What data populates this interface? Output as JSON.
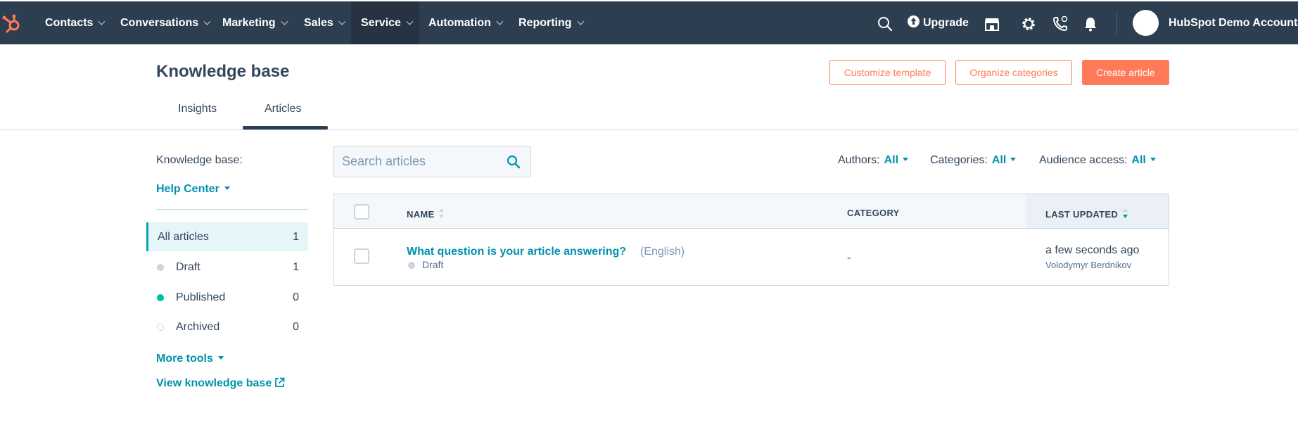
{
  "nav": {
    "items": [
      {
        "label": "Contacts"
      },
      {
        "label": "Conversations"
      },
      {
        "label": "Marketing"
      },
      {
        "label": "Sales"
      },
      {
        "label": "Service"
      },
      {
        "label": "Automation"
      },
      {
        "label": "Reporting"
      }
    ],
    "active_item": "Service",
    "upgrade_label": "Upgrade",
    "account_name": "HubSpot Demo Account",
    "icons": [
      "search-icon",
      "marketplace-icon",
      "settings-gear-icon",
      "calling-icon",
      "notifications-bell-icon"
    ]
  },
  "header": {
    "title": "Knowledge base",
    "buttons": {
      "customize": "Customize template",
      "organize": "Organize categories",
      "create": "Create article"
    },
    "tabs": [
      {
        "label": "Insights"
      },
      {
        "label": "Articles"
      }
    ],
    "active_tab": "Articles"
  },
  "sidebar": {
    "heading": "Knowledge base:",
    "kb_selector": "Help Center",
    "items": [
      {
        "label": "All articles",
        "count": "1"
      },
      {
        "label": "Draft",
        "count": "1"
      },
      {
        "label": "Published",
        "count": "0"
      },
      {
        "label": "Archived",
        "count": "0"
      }
    ],
    "more_tools": "More tools",
    "view_kb": "View knowledge base"
  },
  "filters": {
    "search_placeholder": "Search articles",
    "authors": {
      "label": "Authors:",
      "value": "All"
    },
    "categories": {
      "label": "Categories:",
      "value": "All"
    },
    "audience": {
      "label": "Audience access:",
      "value": "All"
    }
  },
  "table": {
    "columns": {
      "name": "NAME",
      "category": "CATEGORY",
      "updated": "LAST UPDATED"
    },
    "rows": [
      {
        "title": "What question is your article answering?",
        "language": "(English)",
        "status": "Draft",
        "category": "-",
        "updated": "a few seconds ago",
        "author": "Volodymyr Berdnikov"
      }
    ]
  },
  "colors": {
    "nav_bg": "#2d3e50",
    "accent_orange": "#ff7a59",
    "link_teal": "#0091ae",
    "published_green": "#00bda5"
  }
}
